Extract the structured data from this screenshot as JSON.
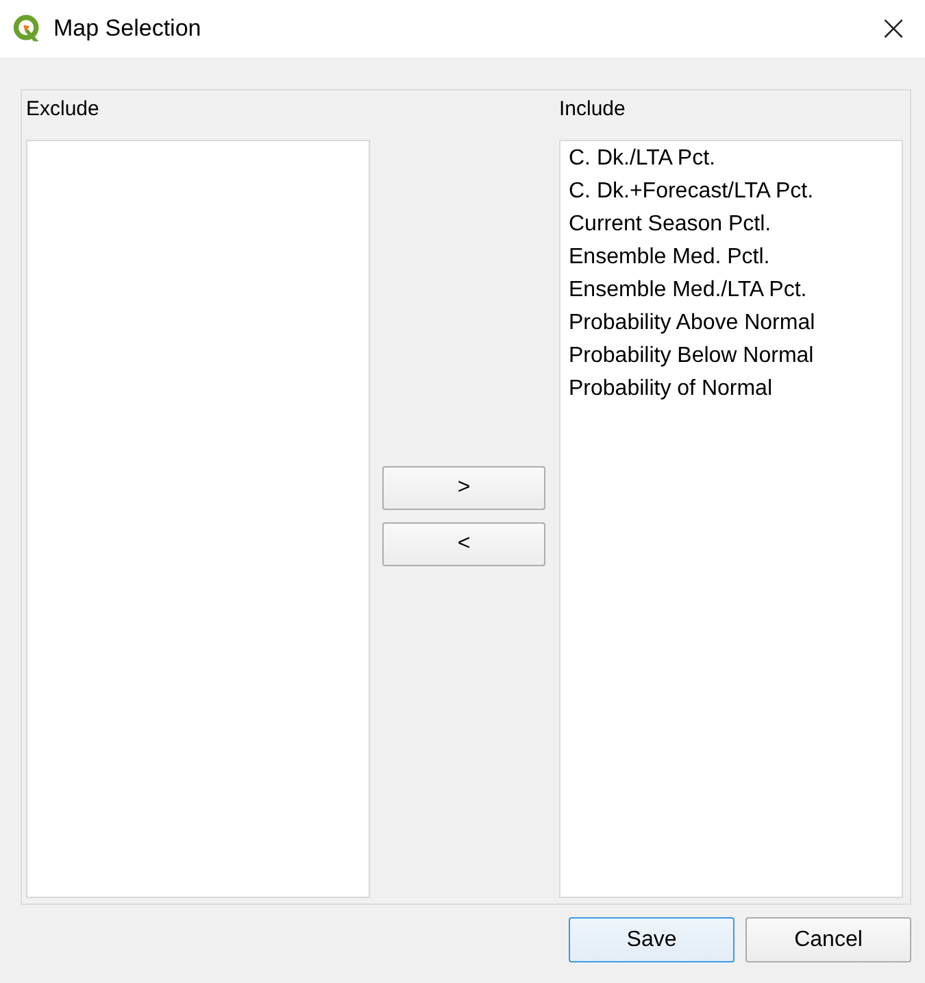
{
  "window": {
    "title": "Map Selection",
    "close": "×"
  },
  "exclude": {
    "label": "Exclude"
  },
  "move_buttons": [
    ">",
    "<"
  ],
  "include": {
    "label": "Include",
    "items": [
      "C. Dk./LTA Pct.",
      "C. Dk.+Forecast/LTA Pct.",
      "Current Season Pctl.",
      "Ensemble Med. Pctl.",
      "Ensemble Med./LTA Pct.",
      "Probability Above Normal",
      "Probability Below Normal",
      "Probability of Normal"
    ]
  },
  "buttons": [
    {
      "label": "Save",
      "default": true
    },
    {
      "label": "Cancel",
      "default": false
    }
  ]
}
